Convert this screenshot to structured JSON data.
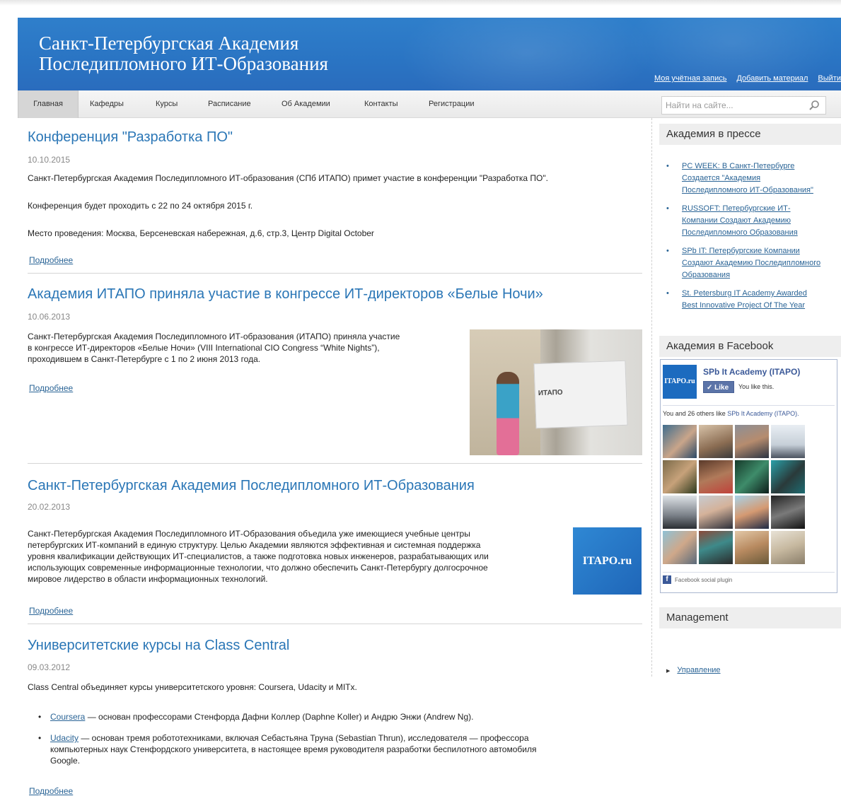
{
  "header": {
    "title_line1": "Санкт-Петербургская Академия",
    "title_line2": "Последипломного ИТ-Образования",
    "user_links": [
      "Моя учётная запись",
      "Добавить материал",
      "Выйти"
    ]
  },
  "nav": {
    "tabs": [
      "Главная",
      "Кафедры",
      "Курсы",
      "Расписание",
      "Об Академии",
      "Контакты",
      "Регистрации"
    ],
    "active": "Главная",
    "search_placeholder": "Найти на сайте..."
  },
  "posts": [
    {
      "title": "Конференция \"Разработка ПО\"",
      "date": "10.10.2015",
      "paragraphs": [
        "Санкт-Петербургская Академия Последипломного ИТ-образования (СПб  ИТАПО) примет участие в конференции \"Разработка ПО\".",
        "Конференция будет проходить с 22 по 24 октября 2015 г.",
        "Место проведения: Москва, Берсеневская набережная, д.6, стр.3, Центр Digital October"
      ],
      "more": "Подробнее"
    },
    {
      "title": "Академия ИТАПО приняла участие в конгрессе ИТ-директоров «Белые Ночи»",
      "date": "10.06.2013",
      "text_lines": [
        "Санкт-Петербургская Академия Последипломного ИТ-образования (ИТАПО) приняла участие",
        "в конгрессе ИТ-директоров «Белые Ночи» (VIII International CIO Congress “White Nights”),",
        "проходившем в Санкт-Петербурге с 1 по 2 июня 2013 года."
      ],
      "image_banner_text": "ИТАПО",
      "more": "Подробнее"
    },
    {
      "title": "Санкт-Петербургская Академия Последипломного ИТ-Образования",
      "date": "20.02.2013",
      "text_lines": [
        "Санкт-Петербургская Академия Последипломного ИТ-Образования объедила уже имеющиеся учебные центры",
        "петербургских ИТ-компаний в единую структуру. Целью Академии являются эффективная и системная поддержка",
        "уровня квалификации действующих ИТ-специалистов, а также подготовка новых инженеров, разрабатывающих или",
        "использующих современные информационные технологии, что должно обеспечить Санкт-Петербургу долгосрочное",
        "мировое лидерство в области информационных технологий."
      ],
      "logo_text": "ITAPO.ru",
      "more": "Подробнее"
    },
    {
      "title": "Университетские курсы на Class Central",
      "date": "09.03.2012",
      "intro": "Class Central объединяет курсы университетского уровня: Coursera, Udacity и MITx.",
      "items": [
        {
          "link": "Coursera",
          "lines": [
            " — основан профессорами Стенфорда Дафни Коллер (Daphne Koller) и Андрю Энжи (Andrew Ng)."
          ]
        },
        {
          "link": "Udacity",
          "lines": [
            " — основан тремя робототехниками, включая Себастьяна Труна (Sebastian Thrun), исследователя — профессора",
            "компьютерных наук Стенфордского университета, в настоящее время руководителя разработки беспилотного автомобиля",
            "Google."
          ]
        }
      ],
      "more": "Подробнее"
    }
  ],
  "sidebar": {
    "press_title": "Академия в прессе",
    "press_items": [
      [
        "PC WEEK: В Санкт-Петербурге",
        "Создается \"Академия",
        "Последипломного ИТ-Образования\""
      ],
      [
        "RUSSOFT: Петербургские ИТ-",
        "Компании Создают Академию",
        "Последипломного Образования"
      ],
      [
        "SPb IT: Петербургские Компании",
        "Создают Академию Последипломного",
        "Образования"
      ],
      [
        "St. Petersburg IT Academy Awarded",
        "Best Innovative Project Of The Year"
      ]
    ],
    "facebook_title": "Академия в Facebook",
    "facebook": {
      "logo_text": "ITAPO.ru",
      "page_name": "SPb It Academy (ITAPO)",
      "like_label": "✓ Like",
      "like_text": "You like this.",
      "count_text": "You and 26 others like ",
      "count_link": "SPb It Academy (ITAPO).",
      "plugin_label": "Facebook social plugin"
    },
    "management_title": "Management",
    "management_items": [
      "Управление"
    ]
  },
  "colors": {
    "header_blue": "#2a74c3",
    "link_blue": "#2a6496",
    "title_blue": "#2a76b6",
    "facebook_blue": "#3b5998"
  }
}
